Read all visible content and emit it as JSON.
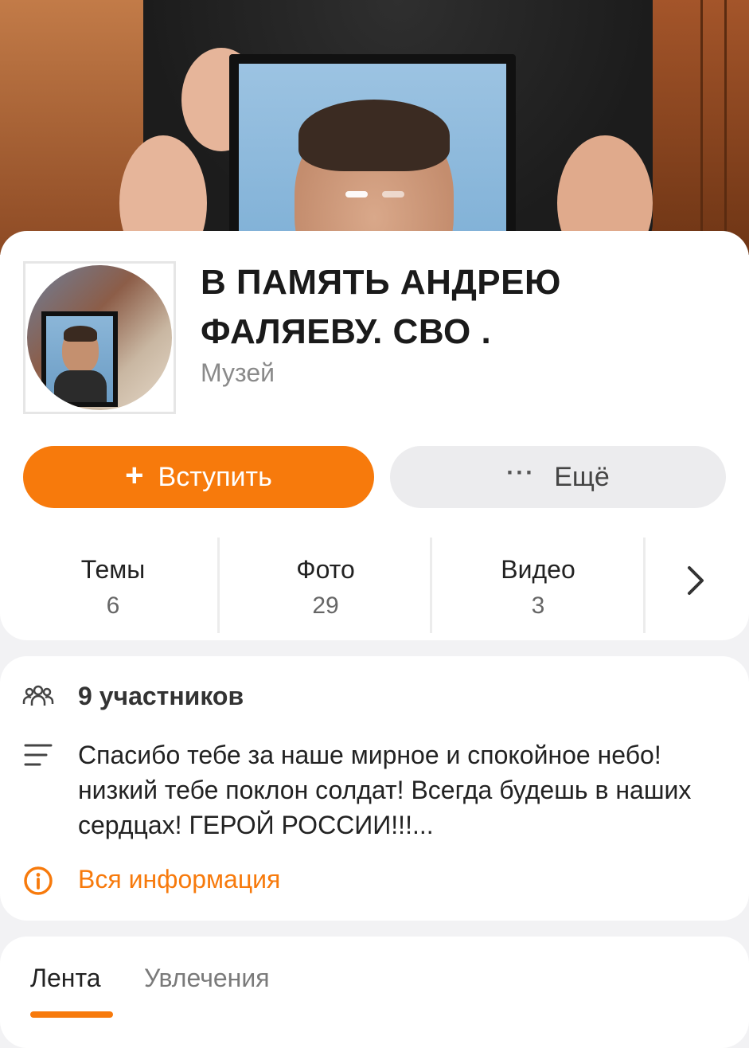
{
  "group": {
    "title": "В ПАМЯТЬ АНДРЕЮ ФАЛЯЕВУ. СВО .",
    "category": "Музей"
  },
  "cover": {
    "slides_total": 2,
    "slide_active": 1
  },
  "actions": {
    "join_label": "Вступить",
    "more_label": "Ещё"
  },
  "stats": [
    {
      "label": "Темы",
      "count": "6"
    },
    {
      "label": "Фото",
      "count": "29"
    },
    {
      "label": "Видео",
      "count": "3"
    }
  ],
  "info": {
    "members": "9 участников",
    "description": "Спасибо тебе за наше мирное и спокойное небо! низкий тебе поклон солдат! Всегда будешь в наших сердцах! ГЕРОЙ РОССИИ!!!...",
    "all_info_label": "Вся информация"
  },
  "tabs": [
    {
      "label": "Лента",
      "active": true
    },
    {
      "label": "Увлечения",
      "active": false
    }
  ],
  "colors": {
    "accent": "#f77a0c",
    "background": "#f2f2f4",
    "secondary_button": "#ececee"
  },
  "icons": {
    "join": "plus-icon",
    "more": "ellipsis-icon",
    "stats_next": "chevron-right-icon",
    "members": "people-icon",
    "description": "lines-icon",
    "all_info": "info-icon"
  }
}
